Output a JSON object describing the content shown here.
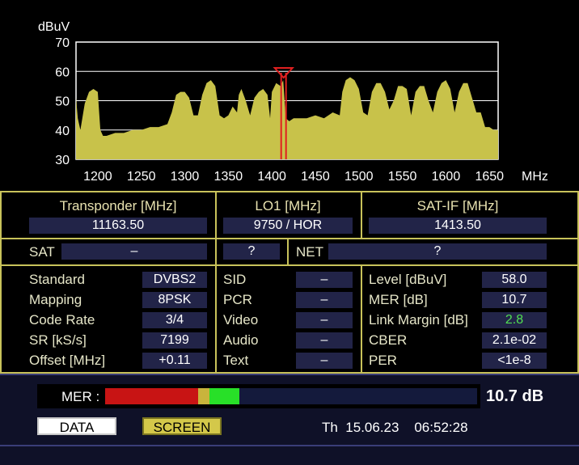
{
  "spectrum": {
    "y_unit": "dBuV",
    "x_unit": "MHz",
    "y_ticks": [
      "70",
      "60",
      "50",
      "40",
      "30"
    ],
    "x_ticks": [
      "1200",
      "1250",
      "1300",
      "1350",
      "1400",
      "1450",
      "1500",
      "1550",
      "1600",
      "1650"
    ],
    "fill_color": "#c8c24a",
    "marker_color": "#e02020"
  },
  "chart_data": {
    "type": "area",
    "xlabel": "MHz",
    "ylabel": "dBuV",
    "ylim": [
      30,
      70
    ],
    "xlim": [
      1175,
      1660
    ],
    "grid": true,
    "marker_x": 1413.5,
    "x": [
      1175,
      1177,
      1180,
      1185,
      1190,
      1195,
      1200,
      1203,
      1206,
      1210,
      1220,
      1230,
      1240,
      1250,
      1260,
      1270,
      1280,
      1285,
      1290,
      1295,
      1300,
      1305,
      1310,
      1315,
      1320,
      1325,
      1330,
      1335,
      1340,
      1345,
      1350,
      1355,
      1360,
      1362,
      1365,
      1370,
      1375,
      1380,
      1385,
      1390,
      1395,
      1398,
      1400,
      1405,
      1410,
      1413,
      1416,
      1420,
      1425,
      1430,
      1440,
      1450,
      1460,
      1470,
      1478,
      1481,
      1485,
      1490,
      1495,
      1500,
      1505,
      1510,
      1515,
      1520,
      1525,
      1530,
      1535,
      1540,
      1545,
      1550,
      1555,
      1560,
      1565,
      1570,
      1575,
      1580,
      1585,
      1590,
      1595,
      1600,
      1605,
      1610,
      1615,
      1620,
      1625,
      1630,
      1635,
      1640,
      1645,
      1650,
      1655,
      1660
    ],
    "y": [
      51,
      44,
      40,
      49,
      53,
      54,
      53,
      40,
      38,
      38,
      39,
      39,
      40,
      40,
      41,
      41,
      42,
      46,
      52,
      53,
      53,
      51,
      45,
      45,
      52,
      56,
      57,
      55,
      45,
      44,
      45,
      48,
      46,
      52,
      54,
      50,
      45,
      51,
      53,
      54,
      52,
      44,
      53,
      56,
      55,
      57,
      44,
      43,
      44,
      44,
      44,
      45,
      44,
      46,
      45,
      53,
      57,
      58,
      57,
      54,
      46,
      45,
      53,
      56,
      56,
      53,
      47,
      50,
      55,
      55,
      54,
      45,
      53,
      55,
      55,
      50,
      46,
      53,
      56,
      57,
      54,
      46,
      53,
      56,
      56,
      51,
      46,
      46,
      41,
      41,
      40,
      40
    ]
  },
  "transponder": {
    "transponder_label": "Transponder [MHz]",
    "transponder_value": "11163.50",
    "lo1_label": "LO1 [MHz]",
    "lo1_value": "9750 / HOR",
    "satif_label": "SAT-IF [MHz]",
    "satif_value": "1413.50"
  },
  "sat": {
    "sat_label": "SAT",
    "sat_value": "–",
    "q_value": "?",
    "net_label": "NET",
    "net_value": "?"
  },
  "params": [
    {
      "label": "Standard",
      "value": "DVBS2"
    },
    {
      "label": "Mapping",
      "value": "8PSK"
    },
    {
      "label": "Code Rate",
      "value": "3/4"
    },
    {
      "label": "SR [kS/s]",
      "value": "7199"
    },
    {
      "label": "Offset [MHz]",
      "value": "+0.11"
    }
  ],
  "service": [
    {
      "label": "SID",
      "value": "–"
    },
    {
      "label": "PCR",
      "value": "–"
    },
    {
      "label": "Video",
      "value": "–"
    },
    {
      "label": "Audio",
      "value": "–"
    },
    {
      "label": "Text",
      "value": "–"
    }
  ],
  "signal": [
    {
      "label": "Level [dBuV]",
      "value": "58.0"
    },
    {
      "label": "MER [dB]",
      "value": "10.7"
    },
    {
      "label": "Link Margin [dB]",
      "value": "2.8"
    },
    {
      "label": "CBER",
      "value": "2.1e-02"
    },
    {
      "label": "PER",
      "value": "<1e-8"
    }
  ],
  "mer_bar": {
    "label": "MER :",
    "value_text": "10.7 dB",
    "fill_fraction": 0.36,
    "red_fraction": 0.25,
    "yellow_fraction": 0.28,
    "colors": {
      "red": "#c81414",
      "yellow": "#c8b43c",
      "green": "#28e028",
      "track": "#141a3c"
    }
  },
  "buttons": {
    "data_label": "DATA",
    "screen_label": "SCREEN"
  },
  "status": {
    "datetime": "Th  15.06.23    06:52:28"
  }
}
